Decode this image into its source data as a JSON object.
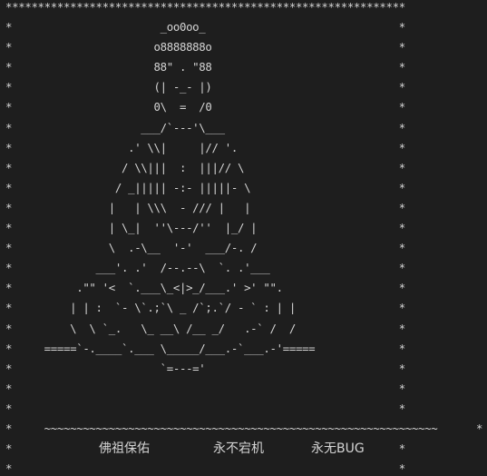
{
  "banner": {
    "lines": [
      "**************************************************************",
      "*                       _oo0oo_                              *",
      "*                      o8888888o                             *",
      "*                      88\" . \"88                             *",
      "*                      (| -_- |)                             *",
      "*                      0\\  =  /0                             *",
      "*                    ___/`---'\\___                           *",
      "*                  .' \\\\|     |// '.                         *",
      "*                 / \\\\|||  :  |||// \\                        *",
      "*                / _||||| -:- |||||- \\                       *",
      "*               |   | \\\\\\  - /// |   |                       *",
      "*               | \\_|  ''\\---/''  |_/ |                      *",
      "*               \\  .-\\__  '-'  ___/-. /                      *",
      "*             ___'. .'  /--.--\\  `. .'___                    *",
      "*          .\"\" '<  `.___\\_<|>_/___.' >' \"\".                  *",
      "*         | | :  `- \\`.;`\\ _ /`;.`/ - ` : | |                *",
      "*         \\  \\ `_.   \\_ __\\ /__ _/   .-` /  /                *",
      "*     =====`-.____`.___ \\_____/___.-`___.-'=====             *",
      "*                       `=---='                              *",
      "*                                                            *",
      "*                                                            *",
      "*     ~~~~~~~~~~~~~~~~~~~~~~~~~~~~~~~~~~~~~~~~~~~~~~~~~~~~~~~~~~~~~      *",
      "*                                                            *",
      "*                                                            *",
      "**************************************************************"
    ]
  },
  "blessing": {
    "line1": "佛祖保佑",
    "line2": "永不宕机",
    "line3": "永无BUG"
  }
}
